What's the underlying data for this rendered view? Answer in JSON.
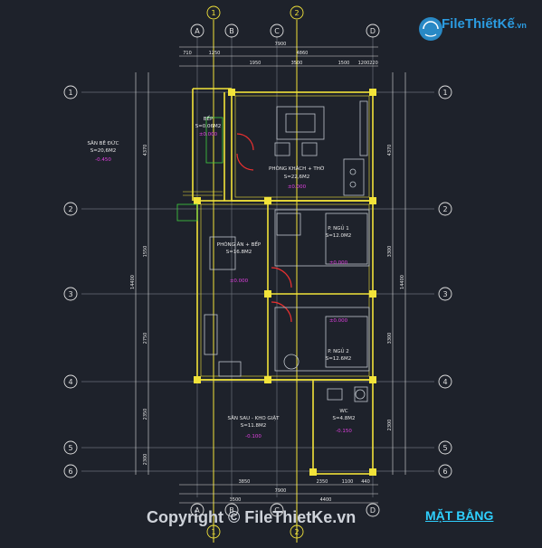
{
  "logo": {
    "text": "FileThiếtKế",
    "domain": ".vn"
  },
  "watermark": "Copyright © FileThietKe.vn",
  "plan_title": "MẶT BẰNG",
  "colors": {
    "background": "#1e222b",
    "wall": "#f2e33a",
    "dim": "#e8e8e8",
    "axis": "#e0e0e0",
    "room_text": "#e8e8e8",
    "level": "#e040e0",
    "accent": "#2fd0ff"
  },
  "axes_vertical": [
    "A",
    "B",
    "C",
    "D"
  ],
  "axes_vertical_extra": [
    "1",
    "2"
  ],
  "axes_horizontal": [
    "1",
    "2",
    "3",
    "4",
    "5",
    "6"
  ],
  "dims_top": {
    "total": "7900",
    "segments_row1": [
      "710",
      "1250",
      "4860"
    ],
    "segments_row2": [
      "1950",
      "3500",
      "1500",
      "1200",
      "220"
    ]
  },
  "dims_bottom": {
    "row1": [
      "3850",
      "2350",
      "1100",
      "440"
    ],
    "total": "7900",
    "row2": [
      "3500",
      "4400"
    ]
  },
  "dims_left": {
    "total": "14400",
    "segments": [
      "4370",
      "1550",
      "2750",
      "2350",
      "2300"
    ]
  },
  "dims_right": {
    "total": "14400",
    "segments": [
      "4370",
      "3300",
      "3300",
      "2300"
    ]
  },
  "rooms": [
    {
      "name": "SÂN BÊ ĐỨC",
      "area": "S=20,6M2",
      "level": "-0.450"
    },
    {
      "name": "BẾP",
      "area": "S=0.06M2",
      "level": "±0.000"
    },
    {
      "name": "PHÒNG KHÁCH + THỜ",
      "area": "S=22,6M2",
      "level": "±0.000"
    },
    {
      "name": "P. NGỦ 1",
      "area": "S=12.0M2",
      "level": "±0.000"
    },
    {
      "name": "PHÒNG ĂN + BẾP",
      "area": "S=16.8M2",
      "level": "±0.000"
    },
    {
      "name": "P. NGỦ 2",
      "area": "S=12.6M2",
      "level": "±0.000"
    },
    {
      "name": "SÂN SAU - KHO GIẶT",
      "area": "S=11.8M2",
      "level": "-0.100"
    },
    {
      "name": "WC",
      "area": "S=4.8M2",
      "level": "-0.150"
    }
  ]
}
